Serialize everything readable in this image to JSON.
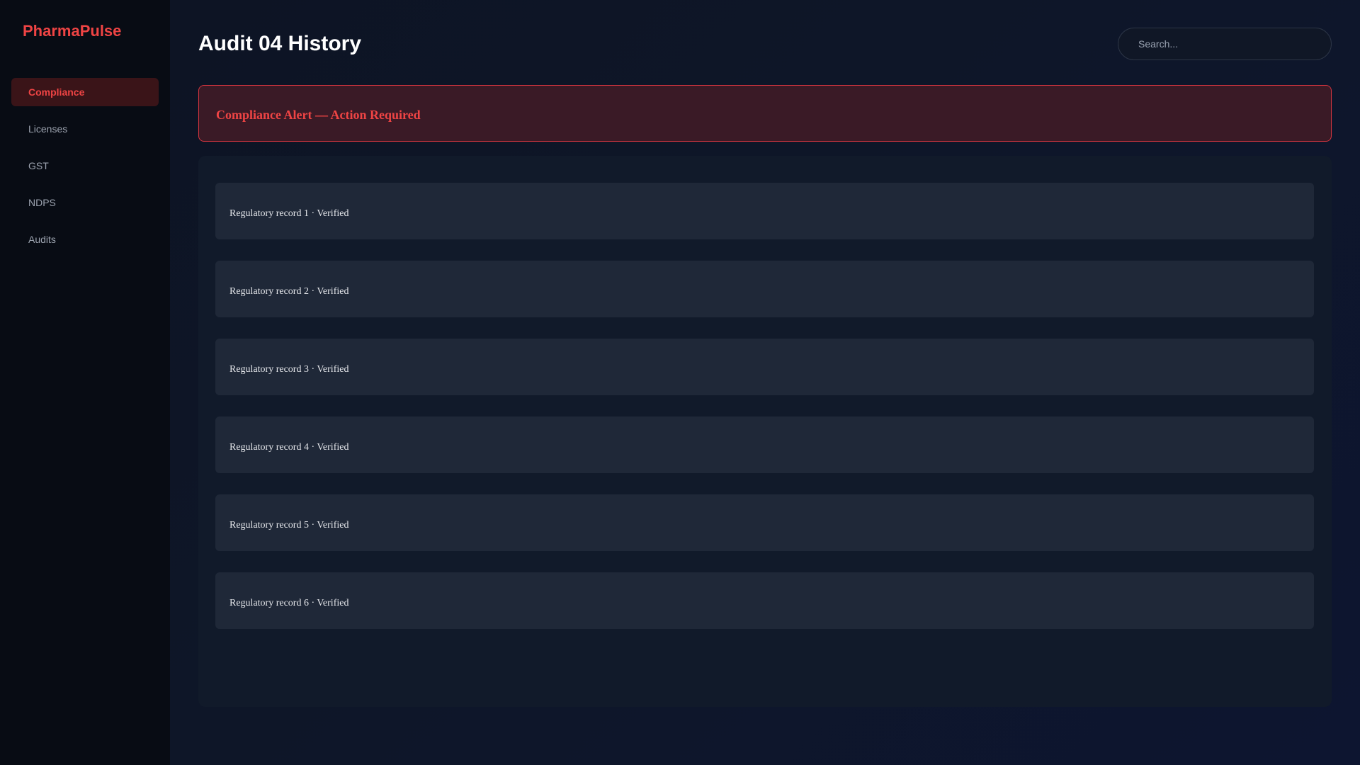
{
  "app": {
    "brand": "PharmaPulse"
  },
  "sidebar": {
    "items": [
      {
        "label": "Compliance",
        "active": true
      },
      {
        "label": "Licenses",
        "active": false
      },
      {
        "label": "GST",
        "active": false
      },
      {
        "label": "NDPS",
        "active": false
      },
      {
        "label": "Audits",
        "active": false
      }
    ]
  },
  "header": {
    "title": "Audit 04 History",
    "search_placeholder": "Search..."
  },
  "alert": {
    "text": "Compliance Alert — Action Required"
  },
  "records": [
    {
      "text": "Regulatory record 1 · Verified"
    },
    {
      "text": "Regulatory record 2 · Verified"
    },
    {
      "text": "Regulatory record 3 · Verified"
    },
    {
      "text": "Regulatory record 4 · Verified"
    },
    {
      "text": "Regulatory record 5 · Verified"
    },
    {
      "text": "Regulatory record 6 · Verified"
    }
  ],
  "colors": {
    "accent": "#ef4444",
    "alert_bg": "#3a1a26",
    "sidebar_bg": "#080c14"
  }
}
